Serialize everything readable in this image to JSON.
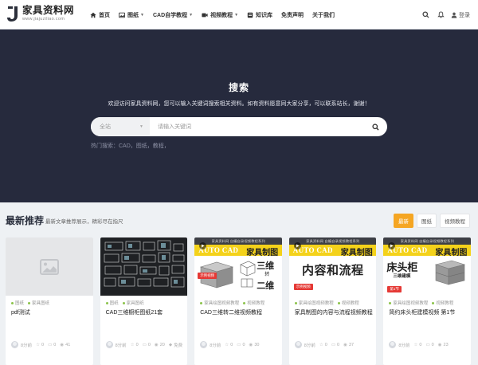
{
  "site": {
    "logo_title": "家具资料网",
    "logo_domain": "www.jiajuziliao.com"
  },
  "nav": {
    "items": [
      {
        "label": "首页",
        "icon": "home-icon",
        "has_caret": false
      },
      {
        "label": "图纸",
        "icon": "image-icon",
        "has_caret": true
      },
      {
        "label": "CAD自学教程",
        "icon": "",
        "has_caret": true
      },
      {
        "label": "视频教程",
        "icon": "video-icon",
        "has_caret": true
      },
      {
        "label": "知识库",
        "icon": "book-icon",
        "has_caret": false
      },
      {
        "label": "免责声明",
        "icon": "",
        "has_caret": false
      },
      {
        "label": "关于我们",
        "icon": "",
        "has_caret": false
      }
    ],
    "login_label": "登录"
  },
  "hero": {
    "title": "搜索",
    "subtitle": "欢迎访问家具资料网，您可以输入关键词搜索相关资料。如有资料愿意同大家分享，可以联系站长，谢谢！",
    "scope_value": "全站",
    "search_placeholder": "请输入关键词",
    "hot_searches": "热门搜索：CAD，图纸，教程，"
  },
  "section": {
    "title": "最新推荐",
    "description": "最新文章推荐展示，精彩尽在指尺",
    "tabs": [
      "最新",
      "图纸",
      "视频教程"
    ],
    "active_tab": 0
  },
  "cards": [
    {
      "categories": [
        "图纸",
        "家具图纸"
      ],
      "title": "pdf测试",
      "views": "8分前",
      "favorites": "0",
      "comments": "0",
      "likes": "41",
      "thumb": {
        "kind": "placeholder"
      }
    },
    {
      "categories": [
        "图纸",
        "家具图纸"
      ],
      "title": "CAD三维橱柜图纸21套",
      "views": "8分前",
      "favorites": "0",
      "comments": "0",
      "likes": "20",
      "extra": "免费",
      "thumb": {
        "kind": "dark-drawings"
      }
    },
    {
      "categories": [
        "家具绘图视频教程",
        "视频教程"
      ],
      "title": "CAD三维转二维视频教程",
      "views": "8分前",
      "favorites": "0",
      "comments": "0",
      "likes": "30",
      "thumb": {
        "kind": "cad",
        "top": "家具资料网 自编自录视频教程系列",
        "left": "AUTO CAD",
        "right": "家具制图",
        "big": "三维",
        "mid": "转",
        "big2": "二维",
        "tag": "示例视频"
      }
    },
    {
      "categories": [
        "家具绘图视频教程",
        "视频教程"
      ],
      "title": "家具制图的内容与流程视频教程",
      "views": "8分前",
      "favorites": "0",
      "comments": "0",
      "likes": "37",
      "thumb": {
        "kind": "cad",
        "top": "家具资料网 自编自录视频教程系列",
        "left": "AUTO CAD",
        "right": "家具制图",
        "big": "内容和流程",
        "tag": "示例视频"
      }
    },
    {
      "categories": [
        "家具绘图视频教程",
        "视频教程"
      ],
      "title": "简约床头柜建模视频 第1节",
      "views": "8分前",
      "favorites": "0",
      "comments": "0",
      "likes": "23",
      "thumb": {
        "kind": "cad",
        "top": "家具资料网 自编自录视频教程系列",
        "left": "AUTO CAD",
        "right": "家具制图",
        "big": "床头柜",
        "mid": "三维建模",
        "tag": "第1节"
      }
    }
  ],
  "colors": {
    "hero_bg": "#262a3d",
    "accent": "#f5a623",
    "cad_yellow": "#f4d21a",
    "tag_red": "#e53935"
  }
}
